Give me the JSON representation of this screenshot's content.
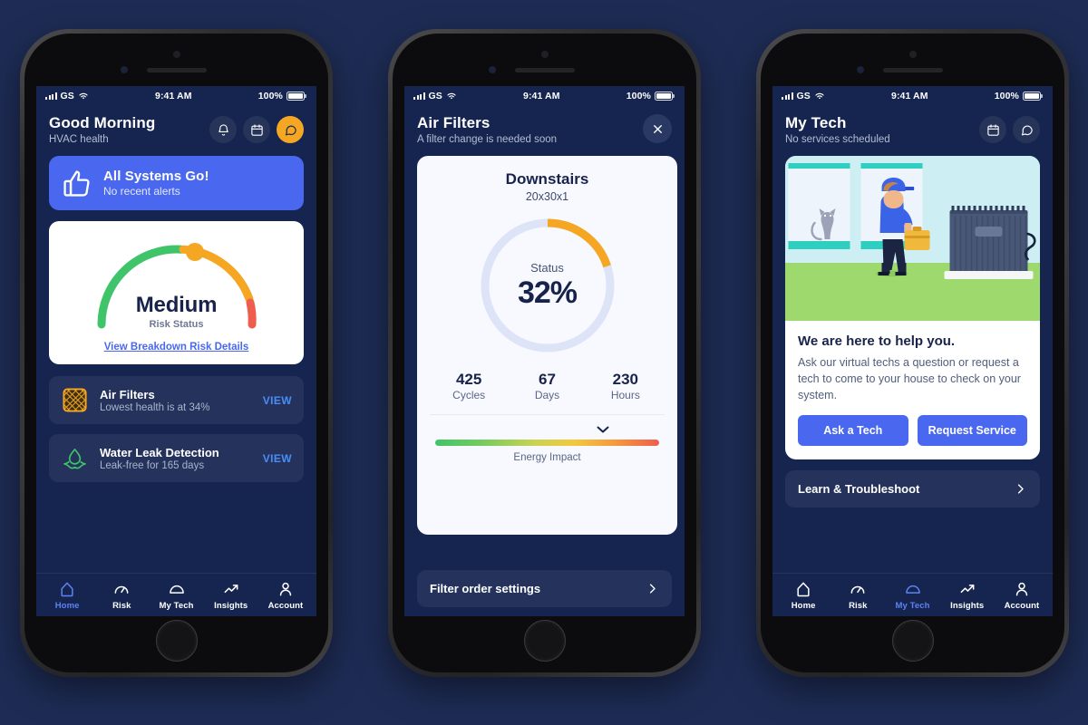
{
  "status_bar": {
    "carrier": "GS",
    "time": "9:41 AM",
    "battery": "100%"
  },
  "nav": {
    "items": [
      {
        "label": "Home",
        "icon": "home-icon"
      },
      {
        "label": "Risk",
        "icon": "gauge-icon"
      },
      {
        "label": "My Tech",
        "icon": "cap-icon"
      },
      {
        "label": "Insights",
        "icon": "trending-up-icon"
      },
      {
        "label": "Account",
        "icon": "person-icon"
      }
    ],
    "active_home": "Home",
    "active_mytech": "My Tech"
  },
  "phone1": {
    "header": {
      "title": "Good Morning",
      "subtitle": "HVAC health",
      "actions": [
        "bell-icon",
        "calendar-icon",
        "chat-icon"
      ]
    },
    "banner": {
      "title": "All Systems Go!",
      "subtitle": "No recent alerts",
      "icon": "thumbs-up-icon",
      "color": "#4a68ef"
    },
    "gauge": {
      "label": "Medium",
      "sublabel": "Risk Status",
      "link": "View Breakdown Risk Details",
      "value_pct": 60,
      "colors": {
        "green": "#3fc46a",
        "orange": "#f5a623",
        "red": "#ef5d4e"
      }
    },
    "rows": [
      {
        "title": "Air Filters",
        "subtitle": "Lowest health is at 34%",
        "action": "VIEW",
        "icon": "filter-mesh-icon"
      },
      {
        "title": "Water Leak Detection",
        "subtitle": "Leak-free for 165 days",
        "action": "VIEW",
        "icon": "water-drop-icon"
      }
    ]
  },
  "phone2": {
    "header": {
      "title": "Air Filters",
      "subtitle": "A filter change is needed soon",
      "close": "close-icon"
    },
    "card": {
      "title": "Downstairs",
      "size": "20x30x1",
      "donut_label": "Status",
      "donut_value": "32%",
      "donut_pct": 20,
      "donut_color": "#f5a623",
      "donut_track": "#dde4f7",
      "stats": [
        {
          "value": "425",
          "label": "Cycles"
        },
        {
          "value": "67",
          "label": "Days"
        },
        {
          "value": "230",
          "label": "Hours"
        }
      ],
      "energy_label": "Energy Impact",
      "energy_marker_pct": 77
    },
    "settings_bar": {
      "label": "Filter order settings",
      "chevron": "chevron-right-icon"
    }
  },
  "phone3": {
    "header": {
      "title": "My Tech",
      "subtitle": "No services scheduled",
      "actions": [
        "calendar-icon",
        "chat-icon"
      ]
    },
    "help": {
      "title": "We are here to help you.",
      "paragraph": "Ask our virtual techs a question or request a tech to come to your house to check on your system.",
      "buttons": [
        "Ask a Tech",
        "Request Service"
      ],
      "illustration": "technician-with-hvac-unit-illustration"
    },
    "learn_bar": {
      "label": "Learn & Troubleshoot",
      "chevron": "chevron-right-icon"
    }
  }
}
